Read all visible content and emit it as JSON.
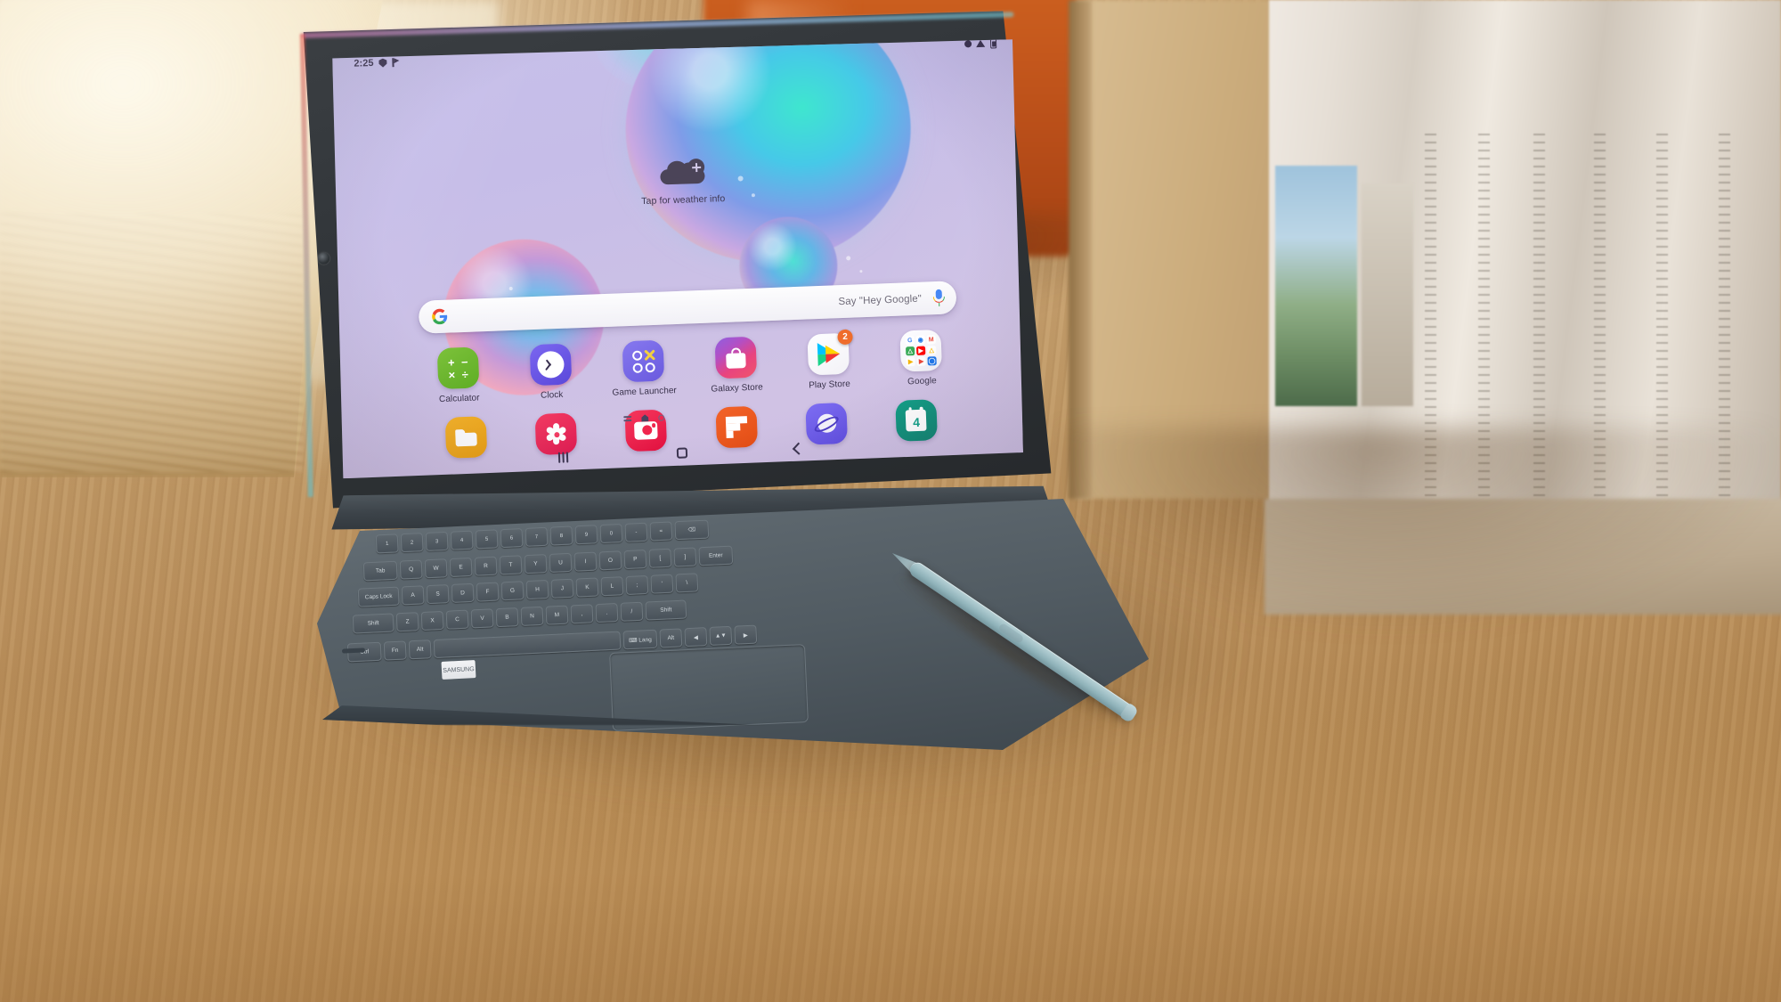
{
  "scene": {
    "description": "Samsung Galaxy Tab S6 tablet on a wooden desk with keyboard cover and S Pen"
  },
  "status_bar": {
    "time": "2:25",
    "left_icons": [
      "shield-icon",
      "flag-icon"
    ],
    "right_icons": [
      "dnd-icon",
      "wifi-icon",
      "battery-icon"
    ]
  },
  "weather_widget": {
    "icon": "cloud-plus-icon",
    "text": "Tap for weather info"
  },
  "search": {
    "logo": "google-logo",
    "hint": "Say \"Hey Google\"",
    "mic_icon": "assistant-mic-icon"
  },
  "apps": {
    "row1": [
      {
        "label": "Calculator",
        "icon": "calculator-icon",
        "ops": [
          "+",
          "−",
          "×",
          "÷"
        ],
        "color": "#6fbb2d",
        "badge": null
      },
      {
        "label": "Clock",
        "icon": "clock-icon",
        "color": "#6a55e6",
        "badge": null
      },
      {
        "label": "Game Launcher",
        "icon": "game-launcher-icon",
        "color": "#7668e8",
        "badge": null
      },
      {
        "label": "Galaxy Store",
        "icon": "galaxy-store-icon",
        "color": "#d64a90",
        "badge": null
      },
      {
        "label": "Play Store",
        "icon": "play-store-icon",
        "color": "#ffffff",
        "badge": "2"
      },
      {
        "label": "Google",
        "icon": "google-folder-icon",
        "color": "#fafaff",
        "badge": null
      }
    ],
    "google_folder_items": [
      {
        "name": "Google",
        "glyph": "G",
        "color": "#ffffff",
        "fg": "#4285f4"
      },
      {
        "name": "Chrome",
        "glyph": "◉",
        "color": "#ffffff",
        "fg": "#4285f4"
      },
      {
        "name": "Gmail",
        "glyph": "M",
        "color": "#ffffff",
        "fg": "#ea4335"
      },
      {
        "name": "Maps",
        "glyph": "△",
        "color": "#34a853",
        "fg": "#ffffff"
      },
      {
        "name": "YouTube",
        "glyph": "▶",
        "color": "#ff0000",
        "fg": "#ffffff"
      },
      {
        "name": "Drive",
        "glyph": "△",
        "color": "#ffffff",
        "fg": "#fbbc05"
      },
      {
        "name": "Play Movies",
        "glyph": "▶",
        "color": "#ffffff",
        "fg": "#f4b400"
      },
      {
        "name": "Play Music",
        "glyph": "▶",
        "color": "#ffffff",
        "fg": "#ea4335"
      },
      {
        "name": "Duo",
        "glyph": "◯",
        "color": "#1a73e8",
        "fg": "#ffffff"
      }
    ],
    "row2": [
      {
        "label": "",
        "icon": "my-files-icon",
        "color": "#f2a81c"
      },
      {
        "label": "",
        "icon": "gallery-icon",
        "color": "#e8215a"
      },
      {
        "label": "",
        "icon": "camera-icon",
        "color": "#ef1f47"
      },
      {
        "label": "",
        "icon": "flipboard-icon",
        "color": "#e8561e"
      },
      {
        "label": "",
        "icon": "samsung-internet-icon",
        "color": "#6b58ea"
      },
      {
        "label": "",
        "icon": "calendar-icon",
        "color": "#0c9483",
        "day": "4"
      }
    ]
  },
  "page_indicator": {
    "items": [
      "app-list-icon",
      "home-page-icon",
      "page-dot-icon"
    ]
  },
  "nav_bar": {
    "buttons": [
      "recents-button",
      "home-button",
      "back-button"
    ]
  },
  "keyboard": {
    "row_numbers": [
      "1",
      "2",
      "3",
      "4",
      "5",
      "6",
      "7",
      "8",
      "9",
      "0",
      "-",
      "=",
      "⌫"
    ],
    "row_q": [
      "Tab",
      "Q",
      "W",
      "E",
      "R",
      "T",
      "Y",
      "U",
      "I",
      "O",
      "P",
      "[",
      "]",
      "Enter"
    ],
    "row_a": [
      "Caps Lock",
      "A",
      "S",
      "D",
      "F",
      "G",
      "H",
      "J",
      "K",
      "L",
      ";",
      "'",
      "\\"
    ],
    "row_z": [
      "Shift",
      "Z",
      "X",
      "C",
      "V",
      "B",
      "N",
      "M",
      ",",
      ".",
      "/",
      "Shift"
    ],
    "row_ctrl": [
      "Ctrl",
      "Fn",
      "Alt",
      "⌨ Lang",
      "Alt",
      "◀",
      "▲▼",
      "▶"
    ],
    "brand": "SAMSUNG"
  },
  "colors": {
    "wallpaper_top": "#c7c0ea",
    "wallpaper_bottom": "#cdbee2",
    "badge": "#ef6c2b",
    "bezel": "#2f3337",
    "keyboard": "#515b62",
    "spen": "#a6c4ca",
    "desk": "#c09a68"
  }
}
